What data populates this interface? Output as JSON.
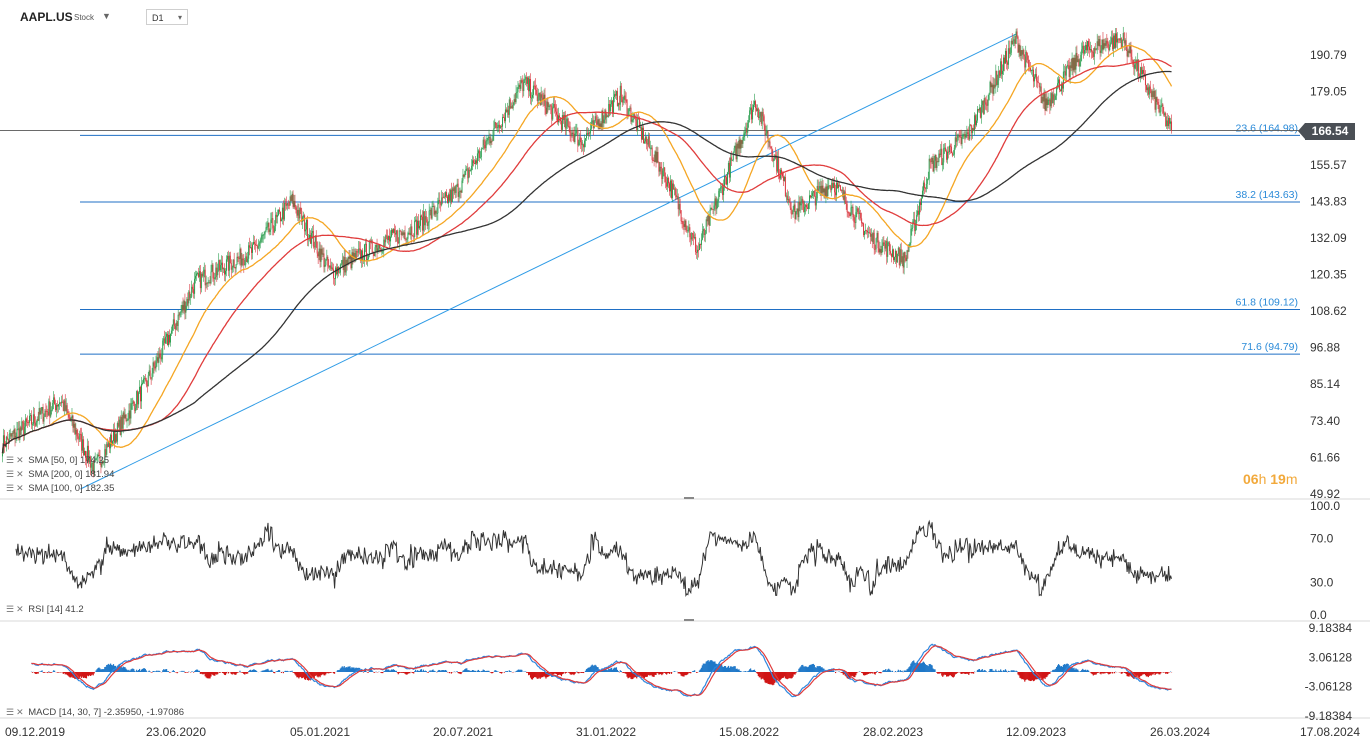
{
  "header": {
    "symbol": "AAPL.US",
    "type": "Stock",
    "timeframe": "D1"
  },
  "price_badge": "166.54",
  "timer": {
    "hours": "06",
    "h": "h",
    "minutes": "19",
    "m": "m"
  },
  "legend": {
    "sma50": "SMA [50, 0] 174.25",
    "sma200": "SMA [200, 0] 181.94",
    "sma100": "SMA [100, 0] 182.35",
    "rsi": "RSI [14] 41.2",
    "macd": "MACD [14, 30, 7] -2.35950, -1.97086"
  },
  "colors": {
    "sma50": "#f5a623",
    "sma200": "#333333",
    "sma100": "#e03c3c",
    "fib": "#1f6fc5",
    "trend": "#2e9be6",
    "up": "#2b9e4f",
    "down": "#d9363e",
    "macd_pos": "#1f78c8",
    "macd_neg": "#d01414"
  },
  "chart_data": [
    {
      "type": "line",
      "name": "price",
      "x": [
        "09.12.2019",
        "23.06.2020",
        "05.01.2021",
        "20.07.2021",
        "31.01.2022",
        "15.08.2022",
        "28.02.2023",
        "12.09.2023",
        "26.03.2024",
        "17.08.2024"
      ],
      "close": [
        66,
        90,
        128,
        147,
        172,
        167,
        148,
        176,
        191,
        166.54
      ],
      "sma50": [
        70,
        85,
        127,
        145,
        168,
        163,
        145,
        181,
        188,
        174.25
      ],
      "sma100": [
        62,
        78,
        118,
        140,
        160,
        162,
        150,
        173,
        184,
        182.35
      ],
      "sma200": [
        55,
        70,
        122,
        141,
        165,
        160,
        152,
        180,
        186,
        181.94
      ],
      "y_ticks": [
        190.79,
        179.05,
        167.31,
        155.57,
        143.83,
        132.09,
        120.35,
        108.62,
        96.88,
        85.14,
        73.4,
        61.66,
        49.92
      ],
      "ylim": [
        49.92,
        198
      ],
      "fib_levels": [
        {
          "label": "23.6 (164.98)",
          "value": 164.98
        },
        {
          "label": "38.2 (143.63)",
          "value": 143.63
        },
        {
          "label": "61.8 (109.12)",
          "value": 109.12
        },
        {
          "label": "71.6 (94.79)",
          "value": 94.79
        }
      ],
      "current_price": 166.54
    },
    {
      "type": "line",
      "name": "RSI",
      "y_ticks": [
        "100.0",
        "70.0",
        "30.0",
        "0.0"
      ],
      "ylim": [
        0,
        100
      ],
      "x": [
        "09.12.2019",
        "23.06.2020",
        "05.01.2021",
        "20.07.2021",
        "31.01.2022",
        "15.08.2022",
        "28.02.2023",
        "12.09.2023",
        "26.03.2024"
      ],
      "values": [
        70,
        55,
        52,
        62,
        48,
        55,
        60,
        55,
        41.2
      ]
    },
    {
      "type": "bar",
      "name": "MACD",
      "y_ticks": [
        "9.18384",
        "3.06128",
        "-3.06128",
        "-9.18384"
      ],
      "ylim": [
        -9.18384,
        9.18384
      ],
      "x": [
        "09.12.2019",
        "23.06.2020",
        "05.01.2021",
        "20.07.2021",
        "31.01.2022",
        "15.08.2022",
        "28.02.2023",
        "12.09.2023",
        "26.03.2024"
      ],
      "values": [
        1.5,
        8,
        -2,
        3,
        7,
        -4,
        4,
        3,
        -2.3595
      ],
      "signal": [
        1.2,
        7,
        -1.5,
        2.5,
        6,
        -3.5,
        3.5,
        2.5,
        -1.97086
      ]
    }
  ],
  "x_labels": [
    "09.12.2019",
    "23.06.2020",
    "05.01.2021",
    "20.07.2021",
    "31.01.2022",
    "15.08.2022",
    "28.02.2023",
    "12.09.2023",
    "26.03.2024",
    "17.08.2024"
  ]
}
